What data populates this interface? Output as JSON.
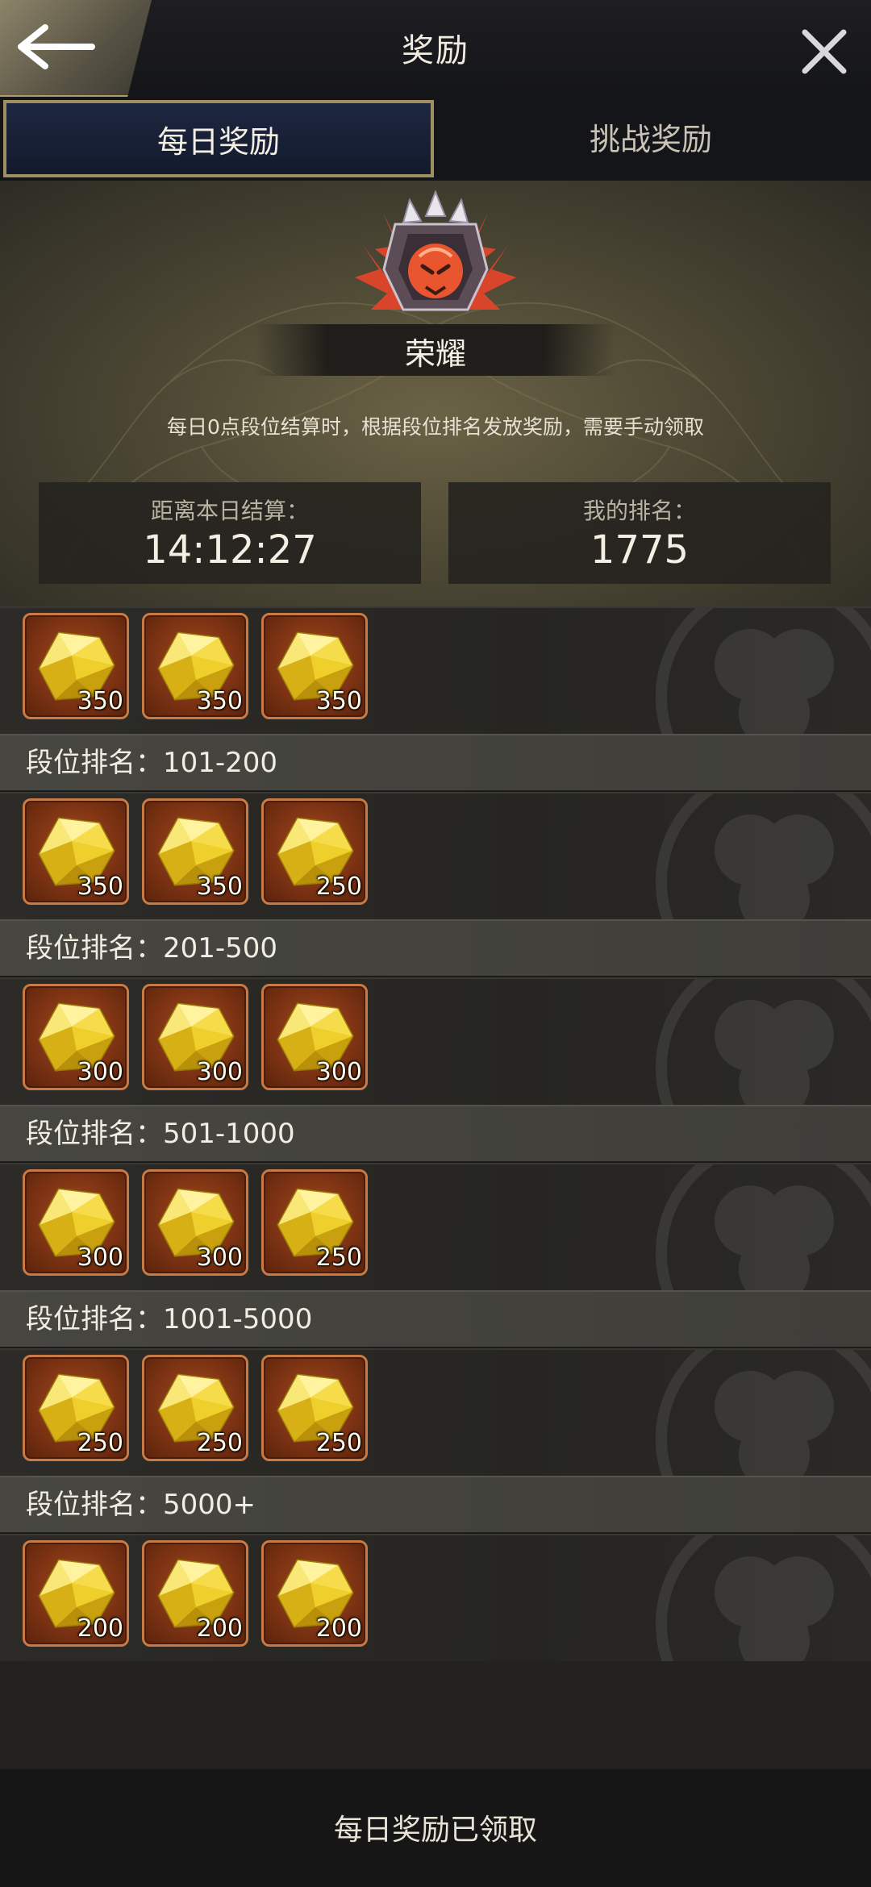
{
  "header": {
    "title": "奖励",
    "back_icon": "arrow-left-icon",
    "close_icon": "close-icon"
  },
  "tabs": [
    {
      "label": "每日奖励",
      "active": true
    },
    {
      "label": "挑战奖励",
      "active": false
    }
  ],
  "banner": {
    "rank_name": "荣耀",
    "description": "每日0点段位结算时，根据段位排名发放奖励，需要手动领取",
    "timer_label": "距离本日结算：",
    "timer_value": "14:12:27",
    "my_rank_label": "我的排名：",
    "my_rank_value": "1775"
  },
  "tiers": [
    {
      "rank_label": null,
      "rewards": [
        "350",
        "350",
        "350"
      ]
    },
    {
      "rank_label": "段位排名：101-200",
      "rewards": [
        "350",
        "350",
        "250"
      ]
    },
    {
      "rank_label": "段位排名：201-500",
      "rewards": [
        "300",
        "300",
        "300"
      ]
    },
    {
      "rank_label": "段位排名：501-1000",
      "rewards": [
        "300",
        "300",
        "250"
      ]
    },
    {
      "rank_label": "段位排名：1001-5000",
      "rewards": [
        "250",
        "250",
        "250"
      ]
    },
    {
      "rank_label": "段位排名：5000+",
      "rewards": [
        "200",
        "200",
        "200"
      ]
    }
  ],
  "footer": {
    "button_label": "每日奖励已领取"
  },
  "colors": {
    "accent_gold": "#a08f60",
    "active_tab_bg": "#1d2740",
    "item_bg": "#7d3313",
    "gem": "#f2d32a"
  }
}
